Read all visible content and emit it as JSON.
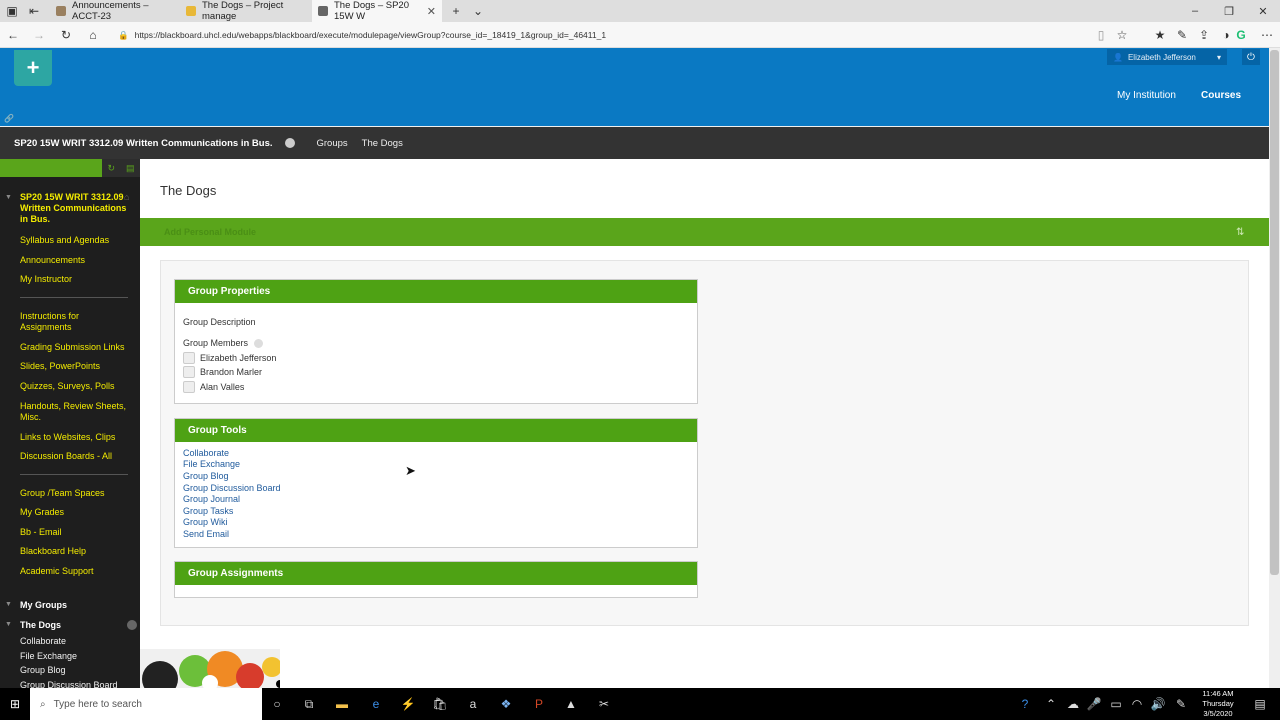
{
  "browser": {
    "tabs": [
      {
        "title": "Announcements – ACCT-23",
        "favicon_color": "#9a8060"
      },
      {
        "title": "The Dogs – Project manage",
        "favicon_color": "#e8b838"
      },
      {
        "title": "The Dogs – SP20 15W W",
        "favicon_color": "#666666"
      }
    ],
    "url": "https://blackboard.uhcl.edu/webapps/blackboard/execute/modulepage/viewGroup?course_id=_18419_1&group_id=_46411_1"
  },
  "header": {
    "user_name": "Elizabeth Jefferson",
    "links": [
      "My Institution",
      "Courses"
    ]
  },
  "course_bar": {
    "course_title": "SP20 15W WRIT 3312.09 Written Communications in Bus.",
    "breadcrumbs": [
      "Groups",
      "The Dogs"
    ]
  },
  "sidebar": {
    "course_title": "SP20 15W WRIT 3312.09 Written Communications in Bus.",
    "section1": [
      "Syllabus and Agendas",
      "Announcements",
      "My Instructor"
    ],
    "section2": [
      "Instructions for Assignments",
      "Grading Submission Links",
      "Slides, PowerPoints",
      "Quizzes, Surveys, Polls",
      "Handouts, Review Sheets, Misc.",
      "Links to Websites, Clips",
      "Discussion Boards - All"
    ],
    "section3": [
      "Group /Team Spaces",
      "My Grades",
      "Bb - Email",
      "Blackboard Help",
      "Academic Support"
    ],
    "my_groups_label": "My Groups",
    "group_name": "The Dogs",
    "group_tools": [
      "Collaborate",
      "File Exchange",
      "Group Blog",
      "Group Discussion Board"
    ]
  },
  "page": {
    "title": "The Dogs",
    "add_module": "Add Personal Module"
  },
  "group_properties": {
    "heading": "Group Properties",
    "description_label": "Group Description",
    "members_label": "Group Members",
    "members": [
      "Elizabeth Jefferson",
      "Brandon Marler",
      "Alan Valles"
    ]
  },
  "group_tools": {
    "heading": "Group Tools",
    "links": [
      "Collaborate",
      "File Exchange",
      "Group Blog",
      "Group Discussion Board",
      "Group Journal",
      "Group Tasks",
      "Group Wiki",
      "Send Email"
    ]
  },
  "group_assignments": {
    "heading": "Group Assignments"
  },
  "taskbar": {
    "search_placeholder": "Type here to search",
    "time": "11:46 AM",
    "day": "Thursday",
    "date": "3/5/2020"
  },
  "colors": {
    "bb_blue": "#0a79c3",
    "bb_green": "#5aa51b",
    "nav_yellow": "#f4ec00"
  }
}
